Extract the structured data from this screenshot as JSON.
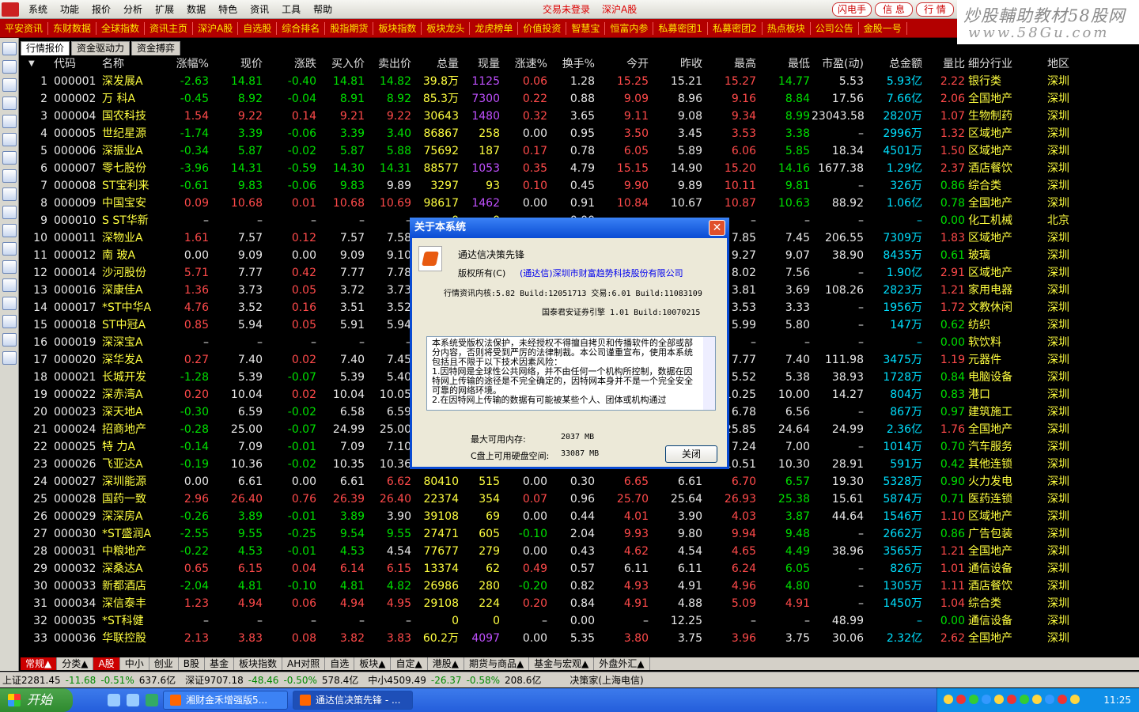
{
  "menu": {
    "items": [
      "系统",
      "功能",
      "报价",
      "分析",
      "扩展",
      "数据",
      "特色",
      "资讯",
      "工具",
      "帮助"
    ],
    "status_trade": "交易未登录",
    "status_market": "深沪A股",
    "buttons": [
      "闪电手",
      "信 息",
      "行 情"
    ]
  },
  "brand": {
    "line1": "炒股輔助教材58股网",
    "line2": "www.58Gu.com"
  },
  "links": [
    "平安资讯",
    "东财数据",
    "全球指数",
    "资讯主页",
    "深沪A股",
    "自选股",
    "综合排名",
    "股指期货",
    "板块指数",
    "板块龙头",
    "龙虎榜单",
    "价值投资",
    "智慧宝",
    "恒富内参",
    "私募密团1",
    "私募密团2",
    "热点板块",
    "公司公告",
    "金股一号"
  ],
  "tabs": [
    "行情报价",
    "资金驱动力",
    "资金搏弈"
  ],
  "columns": [
    "代码",
    "名称",
    "涨幅%",
    "现价",
    "涨跌",
    "买入价",
    "卖出价",
    "总量",
    "现量",
    "涨速%",
    "换手%",
    "今开",
    "昨收",
    "最高",
    "最低",
    "市盈(动)",
    "总金额",
    "量比",
    "细分行业",
    "地区"
  ],
  "rows": [
    {
      "n": "1",
      "code": "000001",
      "name": "深发展A",
      "chg": "-2.63",
      "price": "14.81",
      "diff": "-0.40",
      "bid": "14.81",
      "ask": "14.82",
      "vol": "39.8万",
      "cur": "1125",
      "spd": "0.06",
      "turn": "1.28",
      "open": "15.25",
      "prev": "15.21",
      "high": "15.27",
      "low": "14.77",
      "pe": "5.53",
      "amt": "5.93亿",
      "qr": "2.22",
      "ind": "银行类",
      "reg": "深圳"
    },
    {
      "n": "2",
      "code": "000002",
      "name": "万 科A",
      "chg": "-0.45",
      "price": "8.92",
      "diff": "-0.04",
      "bid": "8.91",
      "ask": "8.92",
      "vol": "85.3万",
      "cur": "7300",
      "spd": "0.22",
      "turn": "0.88",
      "open": "9.09",
      "prev": "8.96",
      "high": "9.16",
      "low": "8.84",
      "pe": "17.56",
      "amt": "7.66亿",
      "qr": "2.06",
      "ind": "全国地产",
      "reg": "深圳"
    },
    {
      "n": "3",
      "code": "000004",
      "name": "国农科技",
      "chg": "1.54",
      "price": "9.22",
      "diff": "0.14",
      "bid": "9.21",
      "ask": "9.22",
      "vol": "30643",
      "cur": "1480",
      "spd": "0.32",
      "turn": "3.65",
      "open": "9.11",
      "prev": "9.08",
      "high": "9.34",
      "low": "8.99",
      "pe": "23043.58",
      "amt": "2820万",
      "qr": "1.07",
      "ind": "生物制药",
      "reg": "深圳"
    },
    {
      "n": "4",
      "code": "000005",
      "name": "世纪星源",
      "chg": "-1.74",
      "price": "3.39",
      "diff": "-0.06",
      "bid": "3.39",
      "ask": "3.40",
      "vol": "86867",
      "cur": "258",
      "spd": "0.00",
      "turn": "0.95",
      "open": "3.50",
      "prev": "3.45",
      "high": "3.53",
      "low": "3.38",
      "pe": "–",
      "amt": "2996万",
      "qr": "1.32",
      "ind": "区域地产",
      "reg": "深圳"
    },
    {
      "n": "5",
      "code": "000006",
      "name": "深振业A",
      "chg": "-0.34",
      "price": "5.87",
      "diff": "-0.02",
      "bid": "5.87",
      "ask": "5.88",
      "vol": "75692",
      "cur": "187",
      "spd": "0.17",
      "turn": "0.78",
      "open": "6.05",
      "prev": "5.89",
      "high": "6.06",
      "low": "5.85",
      "pe": "18.34",
      "amt": "4501万",
      "qr": "1.50",
      "ind": "区域地产",
      "reg": "深圳"
    },
    {
      "n": "6",
      "code": "000007",
      "name": "零七股份",
      "chg": "-3.96",
      "price": "14.31",
      "diff": "-0.59",
      "bid": "14.30",
      "ask": "14.31",
      "vol": "88577",
      "cur": "1053",
      "spd": "0.35",
      "turn": "4.79",
      "open": "15.15",
      "prev": "14.90",
      "high": "15.20",
      "low": "14.16",
      "pe": "1677.38",
      "amt": "1.29亿",
      "qr": "2.37",
      "ind": "酒店餐饮",
      "reg": "深圳"
    },
    {
      "n": "7",
      "code": "000008",
      "name": "ST宝利来",
      "chg": "-0.61",
      "price": "9.83",
      "diff": "-0.06",
      "bid": "9.83",
      "ask": "9.89",
      "vol": "3297",
      "cur": "93",
      "spd": "0.10",
      "turn": "0.45",
      "open": "9.90",
      "prev": "9.89",
      "high": "10.11",
      "low": "9.81",
      "pe": "–",
      "amt": "326万",
      "qr": "0.86",
      "ind": "综合类",
      "reg": "深圳"
    },
    {
      "n": "8",
      "code": "000009",
      "name": "中国宝安",
      "chg": "0.09",
      "price": "10.68",
      "diff": "0.01",
      "bid": "10.68",
      "ask": "10.69",
      "vol": "98617",
      "cur": "1462",
      "spd": "0.00",
      "turn": "0.91",
      "open": "10.84",
      "prev": "10.67",
      "high": "10.87",
      "low": "10.63",
      "pe": "88.92",
      "amt": "1.06亿",
      "qr": "0.78",
      "ind": "全国地产",
      "reg": "深圳"
    },
    {
      "n": "9",
      "code": "000010",
      "name": "S ST华新",
      "chg": "–",
      "price": "–",
      "diff": "–",
      "bid": "–",
      "ask": "–",
      "vol": "0",
      "cur": "0",
      "spd": "–",
      "turn": "0.00",
      "open": "–",
      "prev": "",
      "high": "–",
      "low": "–",
      "pe": "–",
      "amt": "–",
      "qr": "0.00",
      "ind": "化工机械",
      "reg": "北京"
    },
    {
      "n": "10",
      "code": "000011",
      "name": "深物业A",
      "chg": "1.61",
      "price": "7.57",
      "diff": "0.12",
      "bid": "7.57",
      "ask": "7.58",
      "vol": "",
      "cur": "",
      "spd": "",
      "turn": "",
      "open": "",
      "prev": "",
      "high": "7.85",
      "low": "7.45",
      "pe": "206.55",
      "amt": "7309万",
      "qr": "1.83",
      "ind": "区域地产",
      "reg": "深圳"
    },
    {
      "n": "11",
      "code": "000012",
      "name": "南 玻A",
      "chg": "0.00",
      "price": "9.09",
      "diff": "0.00",
      "bid": "9.09",
      "ask": "9.10",
      "vol": "",
      "cur": "",
      "spd": "",
      "turn": "",
      "open": "",
      "prev": "",
      "high": "9.27",
      "low": "9.07",
      "pe": "38.90",
      "amt": "8435万",
      "qr": "0.61",
      "ind": "玻璃",
      "reg": "深圳"
    },
    {
      "n": "12",
      "code": "000014",
      "name": "沙河股份",
      "chg": "5.71",
      "price": "7.77",
      "diff": "0.42",
      "bid": "7.77",
      "ask": "7.78",
      "vol": "",
      "cur": "",
      "spd": "",
      "turn": "",
      "open": "",
      "prev": "",
      "high": "8.02",
      "low": "7.56",
      "pe": "–",
      "amt": "1.90亿",
      "qr": "2.91",
      "ind": "区域地产",
      "reg": "深圳"
    },
    {
      "n": "13",
      "code": "000016",
      "name": "深康佳A",
      "chg": "1.36",
      "price": "3.73",
      "diff": "0.05",
      "bid": "3.72",
      "ask": "3.73",
      "vol": "",
      "cur": "",
      "spd": "",
      "turn": "",
      "open": "",
      "prev": "",
      "high": "3.81",
      "low": "3.69",
      "pe": "108.26",
      "amt": "2823万",
      "qr": "1.21",
      "ind": "家用电器",
      "reg": "深圳"
    },
    {
      "n": "14",
      "code": "000017",
      "name": "*ST中华A",
      "chg": "4.76",
      "price": "3.52",
      "diff": "0.16",
      "bid": "3.51",
      "ask": "3.52",
      "vol": "",
      "cur": "",
      "spd": "",
      "turn": "",
      "open": "",
      "prev": "",
      "high": "3.53",
      "low": "3.33",
      "pe": "–",
      "amt": "1956万",
      "qr": "1.72",
      "ind": "文教休闲",
      "reg": "深圳"
    },
    {
      "n": "15",
      "code": "000018",
      "name": "ST中冠A",
      "chg": "0.85",
      "price": "5.94",
      "diff": "0.05",
      "bid": "5.91",
      "ask": "5.94",
      "vol": "",
      "cur": "",
      "spd": "",
      "turn": "",
      "open": "",
      "prev": "",
      "high": "5.99",
      "low": "5.80",
      "pe": "–",
      "amt": "147万",
      "qr": "0.62",
      "ind": "纺织",
      "reg": "深圳"
    },
    {
      "n": "16",
      "code": "000019",
      "name": "深深宝A",
      "chg": "–",
      "price": "–",
      "diff": "–",
      "bid": "–",
      "ask": "–",
      "vol": "",
      "cur": "",
      "spd": "",
      "turn": "",
      "open": "",
      "prev": "",
      "high": "–",
      "low": "–",
      "pe": "–",
      "amt": "–",
      "qr": "0.00",
      "ind": "软饮料",
      "reg": "深圳"
    },
    {
      "n": "17",
      "code": "000020",
      "name": "深华发A",
      "chg": "0.27",
      "price": "7.40",
      "diff": "0.02",
      "bid": "7.40",
      "ask": "7.45",
      "vol": "",
      "cur": "",
      "spd": "",
      "turn": "",
      "open": "",
      "prev": "",
      "high": "7.77",
      "low": "7.40",
      "pe": "111.98",
      "amt": "3475万",
      "qr": "1.19",
      "ind": "元器件",
      "reg": "深圳"
    },
    {
      "n": "18",
      "code": "000021",
      "name": "长城开发",
      "chg": "-1.28",
      "price": "5.39",
      "diff": "-0.07",
      "bid": "5.39",
      "ask": "5.40",
      "vol": "",
      "cur": "",
      "spd": "",
      "turn": "",
      "open": "",
      "prev": "",
      "high": "5.52",
      "low": "5.38",
      "pe": "38.93",
      "amt": "1728万",
      "qr": "0.84",
      "ind": "电脑设备",
      "reg": "深圳"
    },
    {
      "n": "19",
      "code": "000022",
      "name": "深赤湾A",
      "chg": "0.20",
      "price": "10.04",
      "diff": "0.02",
      "bid": "10.04",
      "ask": "10.05",
      "vol": "",
      "cur": "",
      "spd": "",
      "turn": "",
      "open": "",
      "prev": "",
      "high": "10.25",
      "low": "10.00",
      "pe": "14.27",
      "amt": "804万",
      "qr": "0.83",
      "ind": "港口",
      "reg": "深圳"
    },
    {
      "n": "20",
      "code": "000023",
      "name": "深天地A",
      "chg": "-0.30",
      "price": "6.59",
      "diff": "-0.02",
      "bid": "6.58",
      "ask": "6.59",
      "vol": "",
      "cur": "",
      "spd": "",
      "turn": "",
      "open": "",
      "prev": "",
      "high": "6.78",
      "low": "6.56",
      "pe": "–",
      "amt": "867万",
      "qr": "0.97",
      "ind": "建筑施工",
      "reg": "深圳"
    },
    {
      "n": "21",
      "code": "000024",
      "name": "招商地产",
      "chg": "-0.28",
      "price": "25.00",
      "diff": "-0.07",
      "bid": "24.99",
      "ask": "25.00",
      "vol": "",
      "cur": "",
      "spd": "",
      "turn": "",
      "open": "",
      "prev": "",
      "high": "25.85",
      "low": "24.64",
      "pe": "24.99",
      "amt": "2.36亿",
      "qr": "1.76",
      "ind": "全国地产",
      "reg": "深圳"
    },
    {
      "n": "22",
      "code": "000025",
      "name": "特 力A",
      "chg": "-0.14",
      "price": "7.09",
      "diff": "-0.01",
      "bid": "7.09",
      "ask": "7.10",
      "vol": "",
      "cur": "",
      "spd": "",
      "turn": "",
      "open": "",
      "prev": "",
      "high": "7.24",
      "low": "7.00",
      "pe": "–",
      "amt": "1014万",
      "qr": "0.70",
      "ind": "汽车服务",
      "reg": "深圳"
    },
    {
      "n": "23",
      "code": "000026",
      "name": "飞亚达A",
      "chg": "-0.19",
      "price": "10.36",
      "diff": "-0.02",
      "bid": "10.35",
      "ask": "10.36",
      "vol": "",
      "cur": "",
      "spd": "",
      "turn": "",
      "open": "",
      "prev": "",
      "high": "10.51",
      "low": "10.30",
      "pe": "28.91",
      "amt": "591万",
      "qr": "0.42",
      "ind": "其他连锁",
      "reg": "深圳"
    },
    {
      "n": "24",
      "code": "000027",
      "name": "深圳能源",
      "chg": "0.00",
      "price": "6.61",
      "diff": "0.00",
      "bid": "6.61",
      "ask": "6.62",
      "vol": "80410",
      "cur": "515",
      "spd": "0.00",
      "turn": "0.30",
      "open": "6.65",
      "prev": "6.61",
      "high": "6.70",
      "low": "6.57",
      "pe": "19.30",
      "amt": "5328万",
      "qr": "0.90",
      "ind": "火力发电",
      "reg": "深圳"
    },
    {
      "n": "25",
      "code": "000028",
      "name": "国药一致",
      "chg": "2.96",
      "price": "26.40",
      "diff": "0.76",
      "bid": "26.39",
      "ask": "26.40",
      "vol": "22374",
      "cur": "354",
      "spd": "0.07",
      "turn": "0.96",
      "open": "25.70",
      "prev": "25.64",
      "high": "26.93",
      "low": "25.38",
      "pe": "15.61",
      "amt": "5874万",
      "qr": "0.71",
      "ind": "医药连锁",
      "reg": "深圳"
    },
    {
      "n": "26",
      "code": "000029",
      "name": "深深房A",
      "chg": "-0.26",
      "price": "3.89",
      "diff": "-0.01",
      "bid": "3.89",
      "ask": "3.90",
      "vol": "39108",
      "cur": "69",
      "spd": "0.00",
      "turn": "0.44",
      "open": "4.01",
      "prev": "3.90",
      "high": "4.03",
      "low": "3.87",
      "pe": "44.64",
      "amt": "1546万",
      "qr": "1.10",
      "ind": "区域地产",
      "reg": "深圳"
    },
    {
      "n": "27",
      "code": "000030",
      "name": "*ST盛润A",
      "chg": "-2.55",
      "price": "9.55",
      "diff": "-0.25",
      "bid": "9.54",
      "ask": "9.55",
      "vol": "27471",
      "cur": "605",
      "spd": "-0.10",
      "turn": "2.04",
      "open": "9.93",
      "prev": "9.80",
      "high": "9.94",
      "low": "9.48",
      "pe": "–",
      "amt": "2662万",
      "qr": "0.86",
      "ind": "广告包装",
      "reg": "深圳"
    },
    {
      "n": "28",
      "code": "000031",
      "name": "中粮地产",
      "chg": "-0.22",
      "price": "4.53",
      "diff": "-0.01",
      "bid": "4.53",
      "ask": "4.54",
      "vol": "77677",
      "cur": "279",
      "spd": "0.00",
      "turn": "0.43",
      "open": "4.62",
      "prev": "4.54",
      "high": "4.65",
      "low": "4.49",
      "pe": "38.96",
      "amt": "3565万",
      "qr": "1.21",
      "ind": "全国地产",
      "reg": "深圳"
    },
    {
      "n": "29",
      "code": "000032",
      "name": "深桑达A",
      "chg": "0.65",
      "price": "6.15",
      "diff": "0.04",
      "bid": "6.14",
      "ask": "6.15",
      "vol": "13374",
      "cur": "62",
      "spd": "0.49",
      "turn": "0.57",
      "open": "6.11",
      "prev": "6.11",
      "high": "6.24",
      "low": "6.05",
      "pe": "–",
      "amt": "826万",
      "qr": "1.01",
      "ind": "通信设备",
      "reg": "深圳"
    },
    {
      "n": "30",
      "code": "000033",
      "name": "新都酒店",
      "chg": "-2.04",
      "price": "4.81",
      "diff": "-0.10",
      "bid": "4.81",
      "ask": "4.82",
      "vol": "26986",
      "cur": "280",
      "spd": "-0.20",
      "turn": "0.82",
      "open": "4.93",
      "prev": "4.91",
      "high": "4.96",
      "low": "4.80",
      "pe": "–",
      "amt": "1305万",
      "qr": "1.11",
      "ind": "酒店餐饮",
      "reg": "深圳"
    },
    {
      "n": "31",
      "code": "000034",
      "name": "深信泰丰",
      "chg": "1.23",
      "price": "4.94",
      "diff": "0.06",
      "bid": "4.94",
      "ask": "4.95",
      "vol": "29108",
      "cur": "224",
      "spd": "0.20",
      "turn": "0.84",
      "open": "4.91",
      "prev": "4.88",
      "high": "5.09",
      "low": "4.91",
      "pe": "–",
      "amt": "1450万",
      "qr": "1.04",
      "ind": "综合类",
      "reg": "深圳"
    },
    {
      "n": "32",
      "code": "000035",
      "name": "*ST科健",
      "chg": "–",
      "price": "–",
      "diff": "–",
      "bid": "–",
      "ask": "–",
      "vol": "0",
      "cur": "0",
      "spd": "–",
      "turn": "0.00",
      "open": "–",
      "prev": "12.25",
      "high": "–",
      "low": "–",
      "pe": "48.99",
      "amt": "–",
      "qr": "0.00",
      "ind": "通信设备",
      "reg": "深圳"
    },
    {
      "n": "33",
      "code": "000036",
      "name": "华联控股",
      "chg": "2.13",
      "price": "3.83",
      "diff": "0.08",
      "bid": "3.82",
      "ask": "3.83",
      "vol": "60.2万",
      "cur": "4097",
      "spd": "0.00",
      "turn": "5.35",
      "open": "3.80",
      "prev": "3.75",
      "high": "3.96",
      "low": "3.75",
      "pe": "30.06",
      "amt": "2.32亿",
      "qr": "2.62",
      "ind": "全国地产",
      "reg": "深圳"
    }
  ],
  "bottom_tabs": [
    "常规▲",
    "分类▲",
    "A股",
    "中小",
    "创业",
    "B股",
    "基金",
    "板块指数",
    "AH对照",
    "自选",
    "板块▲",
    "自定▲",
    "港股▲",
    "期货与商品▲",
    "基金与宏观▲",
    "外盘外汇▲"
  ],
  "statusbar": {
    "sh": "上证2281.45",
    "sh_d": "-11.68",
    "sh_p": "-0.51%",
    "sh_a": "637.6亿",
    "sz": "深证9707.18",
    "sz_d": "-48.46",
    "sz_p": "-0.50%",
    "sz_a": "578.4亿",
    "zx": "中小4509.49",
    "zx_d": "-26.37",
    "zx_p": "-0.58%",
    "zx_a": "208.6亿",
    "site": "决策家(上海电信)"
  },
  "taskbar": {
    "start": "开始",
    "tasks": [
      "湘财金禾增强版5...",
      "通达信决策先锋 - ..."
    ],
    "clock": "11:25"
  },
  "dialog": {
    "title": "关于本系统",
    "product": "通达信决策先锋",
    "copyright": "版权所有(C)",
    "company": "(通达信)深圳市财富趋势科技股份有限公司",
    "kernel": "行情资讯内核:5.82 Build:12051713 交易:6.01 Build:11083109",
    "engine": "国泰君安证券引擎 1.01 Build:10070215",
    "notice": "本系统受版权法保护，未经授权不得擅自拷贝和传播软件的全部或部分内容，否则将受到严厉的法律制裁。本公司谨重宣布，使用本系统包括且不限于以下技术因素风险：\n1.因特网是全球性公共网络，并不由任何一个机构所控制，数据在因特网上传输的途径是不完全确定的，因特网本身并不是一个完全安全可靠的网络环境。\n2.在因特网上传输的数据有可能被某些个人、团体或机构通过",
    "mem_label": "最大可用内存:",
    "mem_val": "2037 MB",
    "disk_label": "C盘上可用硬盘空间:",
    "disk_val": "33087 MB",
    "close": "关闭"
  }
}
